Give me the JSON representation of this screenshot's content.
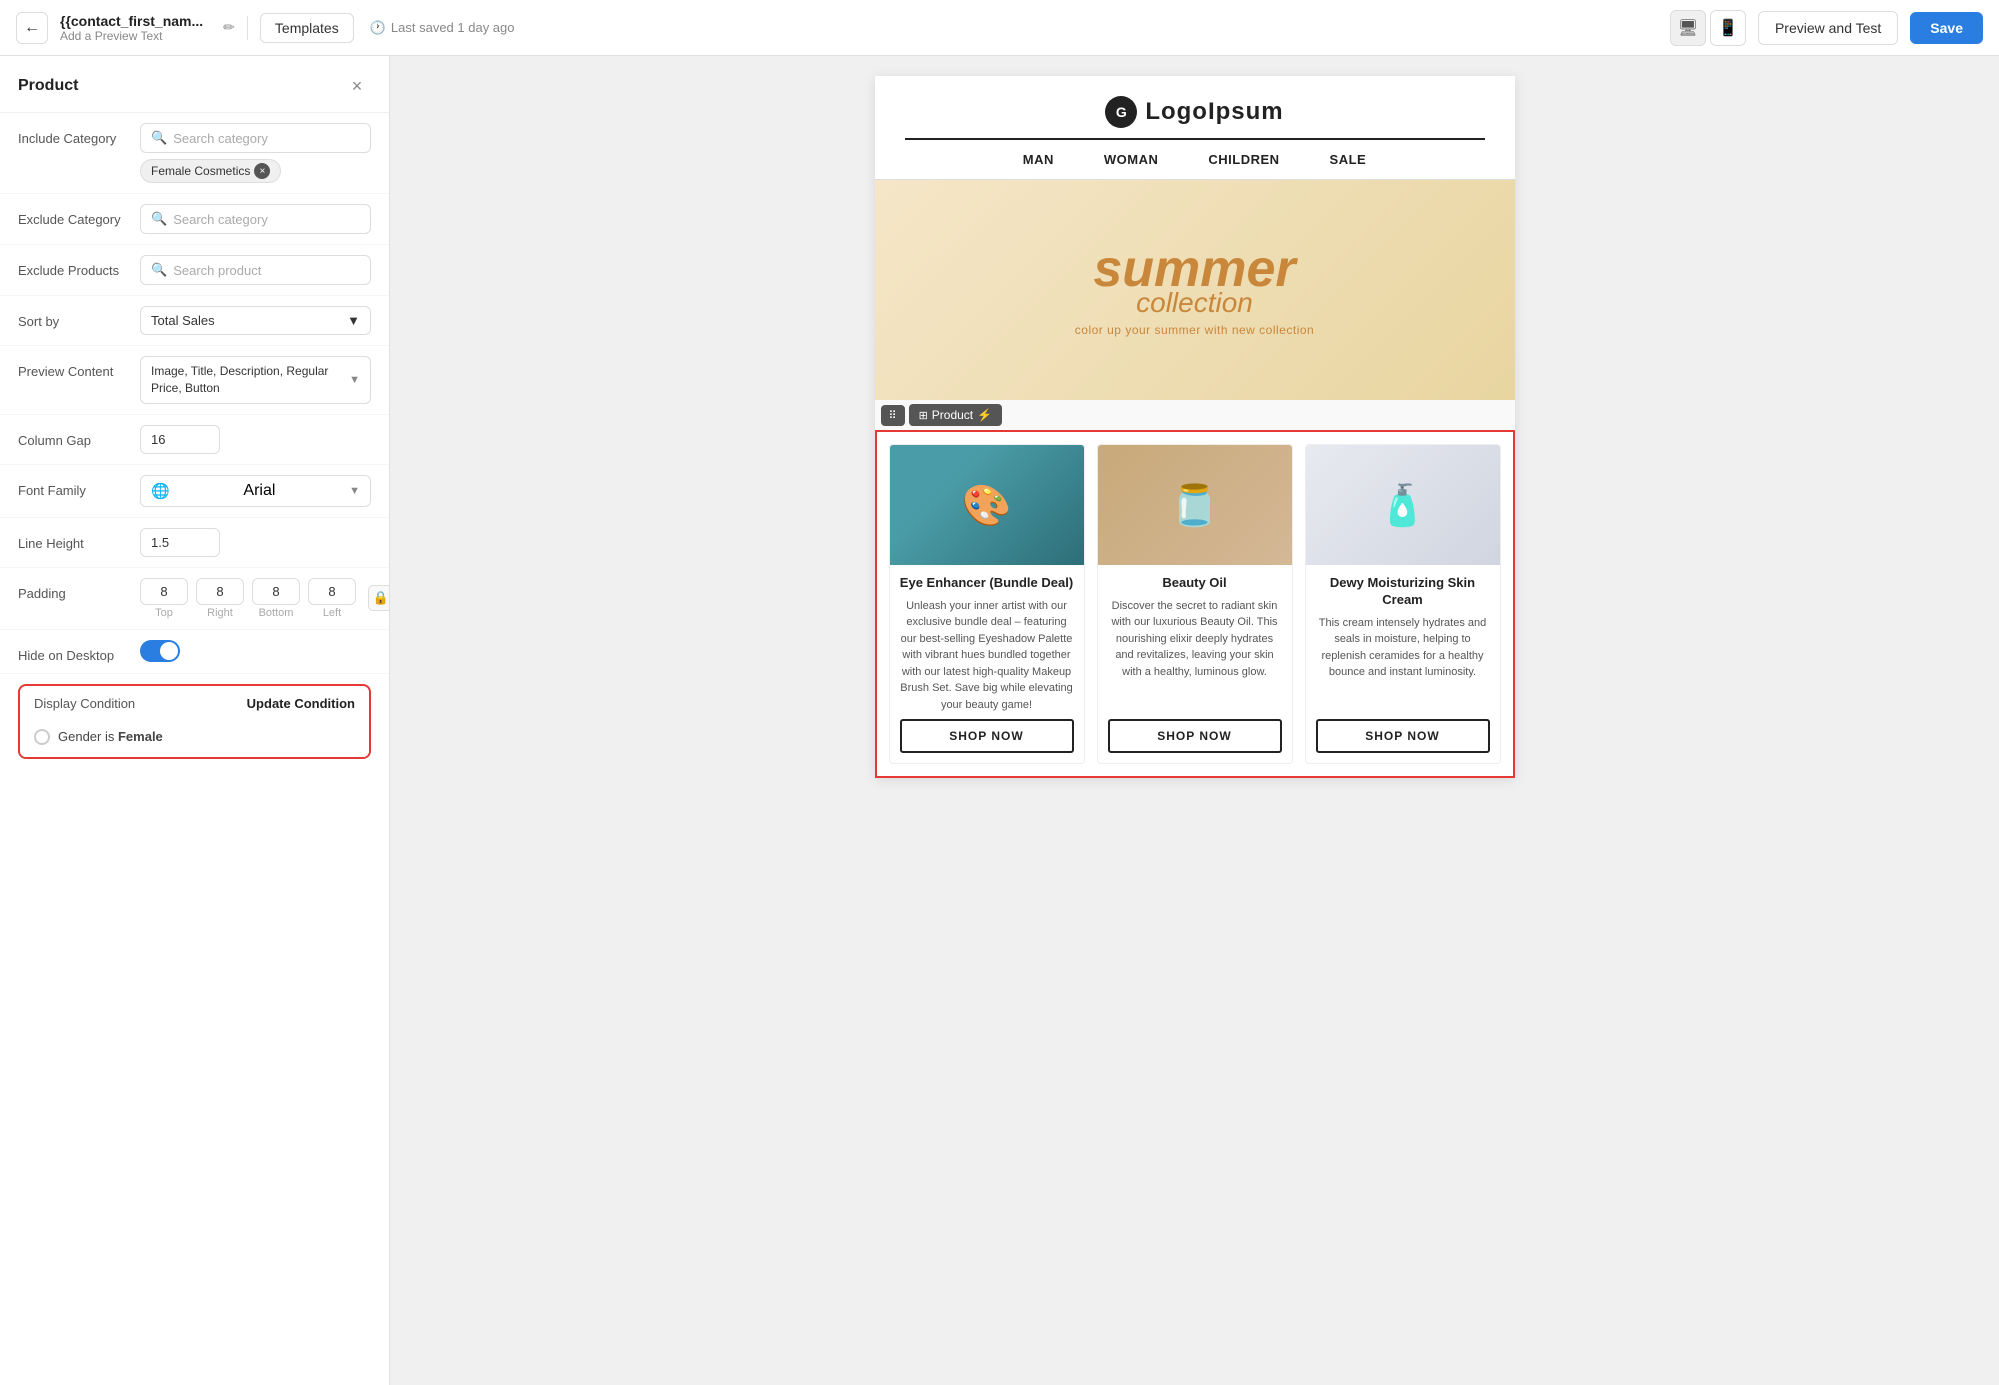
{
  "topbar": {
    "back_button_label": "←",
    "title": "{{contact_first_nam...",
    "subtitle": "Add a Preview Text",
    "edit_icon": "✏",
    "templates_label": "Templates",
    "saved_text": "Last saved 1 day ago",
    "clock_icon": "🕐",
    "desktop_icon": "🖥",
    "mobile_icon": "📱",
    "preview_label": "Preview and Test",
    "save_label": "Save"
  },
  "sidebar": {
    "title": "Product",
    "close_icon": "×",
    "include_category_label": "Include Category",
    "include_category_placeholder": "Search category",
    "tag_label": "Female Cosmetics",
    "exclude_category_label": "Exclude Category",
    "exclude_category_placeholder": "Search category",
    "exclude_products_label": "Exclude Products",
    "exclude_products_placeholder": "Search product",
    "sort_by_label": "Sort by",
    "sort_by_value": "Total Sales",
    "preview_content_label": "Preview Content",
    "preview_content_value": "Image, Title, Description, Regular Price, Button",
    "column_gap_label": "Column Gap",
    "column_gap_value": "16",
    "font_family_label": "Font Family",
    "font_family_value": "Arial",
    "line_height_label": "Line Height",
    "line_height_value": "1.5",
    "padding_label": "Padding",
    "padding_top": "8",
    "padding_right": "8",
    "padding_bottom": "8",
    "padding_left": "8",
    "padding_top_label": "Top",
    "padding_right_label": "Right",
    "padding_bottom_label": "Bottom",
    "padding_left_label": "Left",
    "hide_on_desktop_label": "Hide on Desktop",
    "display_condition_label": "Display Condition",
    "update_condition_label": "Update Condition",
    "condition_text": "Gender is ",
    "condition_value": "Female"
  },
  "email": {
    "logo_letter": "G",
    "logo_name": "LogoIpsum",
    "nav_items": [
      "MAN",
      "WOMAN",
      "CHILDREN",
      "SALE"
    ],
    "banner": {
      "summer": "summer",
      "collection": "collection",
      "tagline": "color up your summer with new collection"
    },
    "product_toolbar": {
      "drag_icon": "⠿",
      "product_label": "Product",
      "lightning": "⚡"
    },
    "products": [
      {
        "name": "Eye Enhancer (Bundle Deal)",
        "description": "Unleash your inner artist with our exclusive bundle deal – featuring our best-selling Eyeshadow Palette with vibrant hues bundled together with our latest high-quality Makeup Brush Set. Save big while elevating your beauty game!",
        "button": "SHOP NOW",
        "image_type": "eye"
      },
      {
        "name": "Beauty Oil",
        "description": "Discover the secret to radiant skin with our luxurious Beauty Oil. This nourishing elixir deeply hydrates and revitalizes, leaving your skin with a healthy, luminous glow.",
        "button": "SHOP NOW",
        "image_type": "oil"
      },
      {
        "name": "Dewy Moisturizing Skin Cream",
        "description": "This cream intensely hydrates and seals in moisture, helping to replenish ceramides for a healthy bounce and instant luminosity.",
        "button": "SHOP NOW",
        "image_type": "cream"
      }
    ]
  }
}
